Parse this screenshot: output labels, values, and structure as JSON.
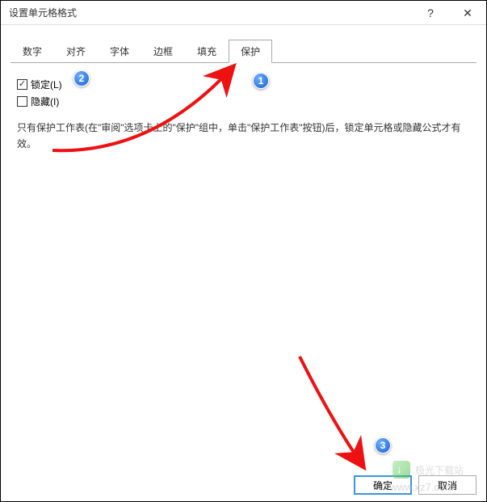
{
  "titlebar": {
    "title": "设置单元格格式",
    "help": "?",
    "close": "✕"
  },
  "tabs": {
    "items": [
      {
        "label": "数字"
      },
      {
        "label": "对齐"
      },
      {
        "label": "字体"
      },
      {
        "label": "边框"
      },
      {
        "label": "填充"
      },
      {
        "label": "保护"
      }
    ]
  },
  "protect": {
    "locked_label": "锁定(L)",
    "hidden_label": "隐藏(I)",
    "help_text": "只有保护工作表(在\"审阅\"选项卡上的\"保护\"组中，单击\"保护工作表\"按钮)后，锁定单元格或隐藏公式才有效。"
  },
  "footer": {
    "ok": "确定",
    "cancel": "取消"
  },
  "annotations": {
    "badge1": "1",
    "badge2": "2",
    "badge3": "3"
  },
  "watermark": {
    "text": "极光下载站",
    "url": "www.xz7.com"
  }
}
